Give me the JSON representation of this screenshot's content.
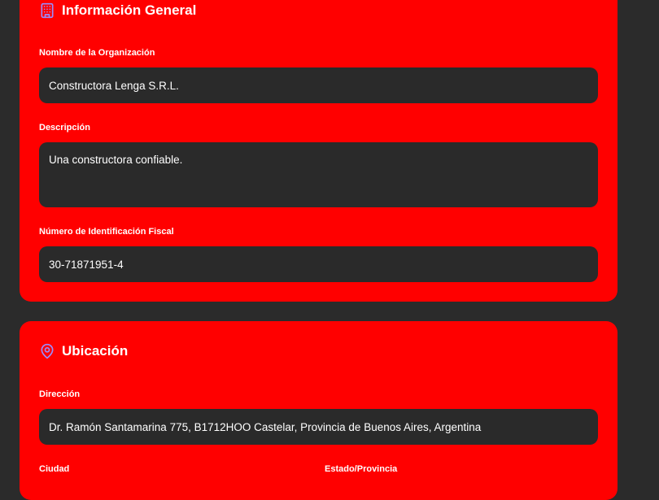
{
  "general": {
    "title": "Información General",
    "org_name_label": "Nombre de la Organización",
    "org_name_value": "Constructora Lenga S.R.L.",
    "description_label": "Descripción",
    "description_value": "Una constructora confiable.",
    "tax_id_label": "Número de Identificación Fiscal",
    "tax_id_value": "30-71871951-4"
  },
  "location": {
    "title": "Ubicación",
    "address_label": "Dirección",
    "address_value": "Dr. Ramón Santamarina 775, B1712HOO Castelar, Provincia de Buenos Aires, Argentina",
    "city_label": "Ciudad",
    "state_label": "Estado/Provincia"
  },
  "icons": {
    "general": "building-icon",
    "location": "map-pin-icon"
  },
  "colors": {
    "card_bg": "#ff0000",
    "page_bg": "#2b2b2b",
    "field_bg": "#2a2a2a",
    "icon": "#9b8cff"
  }
}
